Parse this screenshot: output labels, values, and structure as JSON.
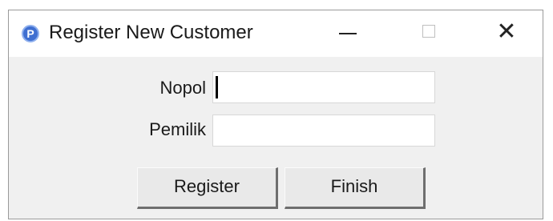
{
  "window": {
    "title": "Register New Customer",
    "app_icon_glyph": "P",
    "controls": {
      "minimize": "minimize-icon",
      "maximize": "maximize-icon",
      "close": "close-icon",
      "close_glyph": "✕"
    }
  },
  "form": {
    "nopol": {
      "label": "Nopol",
      "value": "",
      "focused": true
    },
    "pemilik": {
      "label": "Pemilik",
      "value": ""
    }
  },
  "buttons": {
    "register_label": "Register",
    "finish_label": "Finish"
  },
  "colors": {
    "window_bg": "#f0f0f0",
    "titlebar_bg": "#ffffff",
    "app_icon": "#3f6fd1"
  }
}
